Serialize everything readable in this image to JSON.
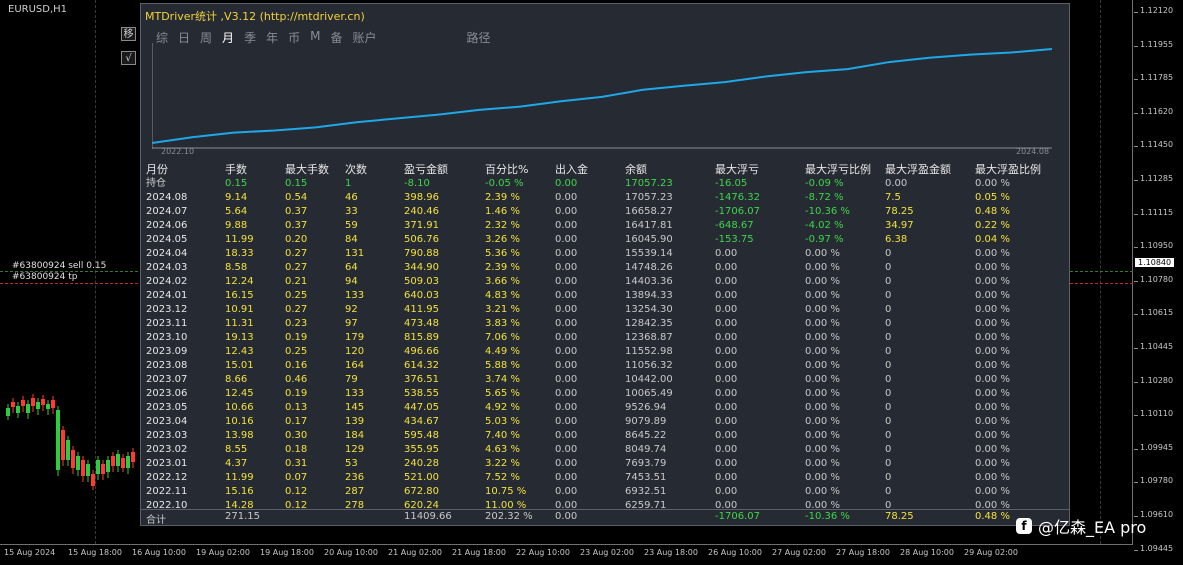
{
  "symbol": "EURUSD,H1",
  "side_buttons": [
    "移",
    "√"
  ],
  "orders": [
    {
      "label": "#63800924 sell 0.15",
      "kind": "sell"
    },
    {
      "label": "#63800924 tp",
      "kind": "tp"
    }
  ],
  "panel": {
    "title": "MTDriver统计 ,V3.12 (http://mtdriver.cn)",
    "tabs": [
      "综",
      "日",
      "周",
      "月",
      "季",
      "年",
      "币",
      "M",
      "备",
      "账户",
      "路径"
    ],
    "active_tab": "月",
    "curve_start": "2022.10",
    "curve_end": "2024.08",
    "curve_color": "#1ea8e8",
    "equity_curve": [
      6259.71,
      6932.51,
      7453.51,
      7693.79,
      8049.74,
      8645.22,
      9079.89,
      9526.94,
      10065.49,
      10442.0,
      11056.32,
      11552.98,
      12368.87,
      12842.35,
      13254.3,
      13894.33,
      14403.36,
      14748.26,
      15539.14,
      16045.9,
      16417.81,
      16658.27,
      17057.23
    ]
  },
  "table": {
    "headers": [
      "月份",
      "手数",
      "最大手数",
      "次数",
      "盈亏金额",
      "百分比%",
      "出入金",
      "余额",
      "最大浮亏",
      "最大浮亏比例",
      "最大浮盈金额",
      "最大浮盈比例"
    ],
    "current": [
      "持仓",
      "0.15",
      "0.15",
      "1",
      "-8.10",
      "-0.05 %",
      "0.00",
      "17057.23",
      "-16.05",
      "-0.09 %",
      "0.00",
      "0.00 %"
    ],
    "rows": [
      [
        "2024.08",
        "9.14",
        "0.54",
        "46",
        "398.96",
        "2.39 %",
        "0.00",
        "17057.23",
        "-1476.32",
        "-8.72 %",
        "7.5",
        "0.05 %"
      ],
      [
        "2024.07",
        "5.64",
        "0.37",
        "33",
        "240.46",
        "1.46 %",
        "0.00",
        "16658.27",
        "-1706.07",
        "-10.36 %",
        "78.25",
        "0.48 %"
      ],
      [
        "2024.06",
        "9.88",
        "0.37",
        "59",
        "371.91",
        "2.32 %",
        "0.00",
        "16417.81",
        "-648.67",
        "-4.02 %",
        "34.97",
        "0.22 %"
      ],
      [
        "2024.05",
        "11.99",
        "0.20",
        "84",
        "506.76",
        "3.26 %",
        "0.00",
        "16045.90",
        "-153.75",
        "-0.97 %",
        "6.38",
        "0.04 %"
      ],
      [
        "2024.04",
        "18.33",
        "0.27",
        "131",
        "790.88",
        "5.36 %",
        "0.00",
        "15539.14",
        "0.00",
        "0.00 %",
        "0",
        "0.00 %"
      ],
      [
        "2024.03",
        "8.58",
        "0.27",
        "64",
        "344.90",
        "2.39 %",
        "0.00",
        "14748.26",
        "0.00",
        "0.00 %",
        "0",
        "0.00 %"
      ],
      [
        "2024.02",
        "12.24",
        "0.21",
        "94",
        "509.03",
        "3.66 %",
        "0.00",
        "14403.36",
        "0.00",
        "0.00 %",
        "0",
        "0.00 %"
      ],
      [
        "2024.01",
        "16.15",
        "0.25",
        "133",
        "640.03",
        "4.83 %",
        "0.00",
        "13894.33",
        "0.00",
        "0.00 %",
        "0",
        "0.00 %"
      ],
      [
        "2023.12",
        "10.91",
        "0.27",
        "92",
        "411.95",
        "3.21 %",
        "0.00",
        "13254.30",
        "0.00",
        "0.00 %",
        "0",
        "0.00 %"
      ],
      [
        "2023.11",
        "11.31",
        "0.23",
        "97",
        "473.48",
        "3.83 %",
        "0.00",
        "12842.35",
        "0.00",
        "0.00 %",
        "0",
        "0.00 %"
      ],
      [
        "2023.10",
        "19.13",
        "0.19",
        "179",
        "815.89",
        "7.06 %",
        "0.00",
        "12368.87",
        "0.00",
        "0.00 %",
        "0",
        "0.00 %"
      ],
      [
        "2023.09",
        "12.43",
        "0.25",
        "120",
        "496.66",
        "4.49 %",
        "0.00",
        "11552.98",
        "0.00",
        "0.00 %",
        "0",
        "0.00 %"
      ],
      [
        "2023.08",
        "15.01",
        "0.16",
        "164",
        "614.32",
        "5.88 %",
        "0.00",
        "11056.32",
        "0.00",
        "0.00 %",
        "0",
        "0.00 %"
      ],
      [
        "2023.07",
        "8.66",
        "0.46",
        "79",
        "376.51",
        "3.74 %",
        "0.00",
        "10442.00",
        "0.00",
        "0.00 %",
        "0",
        "0.00 %"
      ],
      [
        "2023.06",
        "12.45",
        "0.19",
        "133",
        "538.55",
        "5.65 %",
        "0.00",
        "10065.49",
        "0.00",
        "0.00 %",
        "0",
        "0.00 %"
      ],
      [
        "2023.05",
        "10.66",
        "0.13",
        "145",
        "447.05",
        "4.92 %",
        "0.00",
        "9526.94",
        "0.00",
        "0.00 %",
        "0",
        "0.00 %"
      ],
      [
        "2023.04",
        "10.16",
        "0.17",
        "139",
        "434.67",
        "5.03 %",
        "0.00",
        "9079.89",
        "0.00",
        "0.00 %",
        "0",
        "0.00 %"
      ],
      [
        "2023.03",
        "13.98",
        "0.30",
        "184",
        "595.48",
        "7.40 %",
        "0.00",
        "8645.22",
        "0.00",
        "0.00 %",
        "0",
        "0.00 %"
      ],
      [
        "2023.02",
        "8.55",
        "0.18",
        "129",
        "355.95",
        "4.63 %",
        "0.00",
        "8049.74",
        "0.00",
        "0.00 %",
        "0",
        "0.00 %"
      ],
      [
        "2023.01",
        "4.37",
        "0.31",
        "53",
        "240.28",
        "3.22 %",
        "0.00",
        "7693.79",
        "0.00",
        "0.00 %",
        "0",
        "0.00 %"
      ],
      [
        "2022.12",
        "11.99",
        "0.07",
        "236",
        "521.00",
        "7.52 %",
        "0.00",
        "7453.51",
        "0.00",
        "0.00 %",
        "0",
        "0.00 %"
      ],
      [
        "2022.11",
        "15.16",
        "0.12",
        "287",
        "672.80",
        "10.75 %",
        "0.00",
        "6932.51",
        "0.00",
        "0.00 %",
        "0",
        "0.00 %"
      ],
      [
        "2022.10",
        "14.28",
        "0.12",
        "278",
        "620.24",
        "11.00 %",
        "0.00",
        "6259.71",
        "0.00",
        "0.00 %",
        "0",
        "0.00 %"
      ]
    ],
    "totals": {
      "label": "合计",
      "lots": "271.15",
      "profit": "11409.66",
      "percent": "202.32 %",
      "deposit": "0.00",
      "max_dd": "-1706.07",
      "max_dd_pct": "-10.36 %",
      "max_fp": "78.25",
      "max_fp_pct": "0.48 %"
    }
  },
  "price_axis": [
    "1.12120",
    "1.11955",
    "1.11785",
    "1.11620",
    "1.11450",
    "1.11285",
    "1.11115",
    "1.10950",
    "1.10780",
    "1.10615",
    "1.10445",
    "1.10280",
    "1.10110",
    "1.09945",
    "1.09780",
    "1.09610",
    "1.09445"
  ],
  "price_flag": "1.10840",
  "time_axis": [
    "15 Aug 2024",
    "15 Aug 18:00",
    "16 Aug 10:00",
    "19 Aug 02:00",
    "19 Aug 18:00",
    "20 Aug 10:00",
    "21 Aug 02:00",
    "21 Aug 18:00",
    "22 Aug 10:00",
    "23 Aug 02:00",
    "23 Aug 18:00",
    "26 Aug 10:00",
    "27 Aug 02:00",
    "27 Aug 18:00",
    "28 Aug 10:00",
    "29 Aug 02:00"
  ],
  "watermark": "@亿森_EA pro",
  "watermark_icon": "facebook-icon"
}
